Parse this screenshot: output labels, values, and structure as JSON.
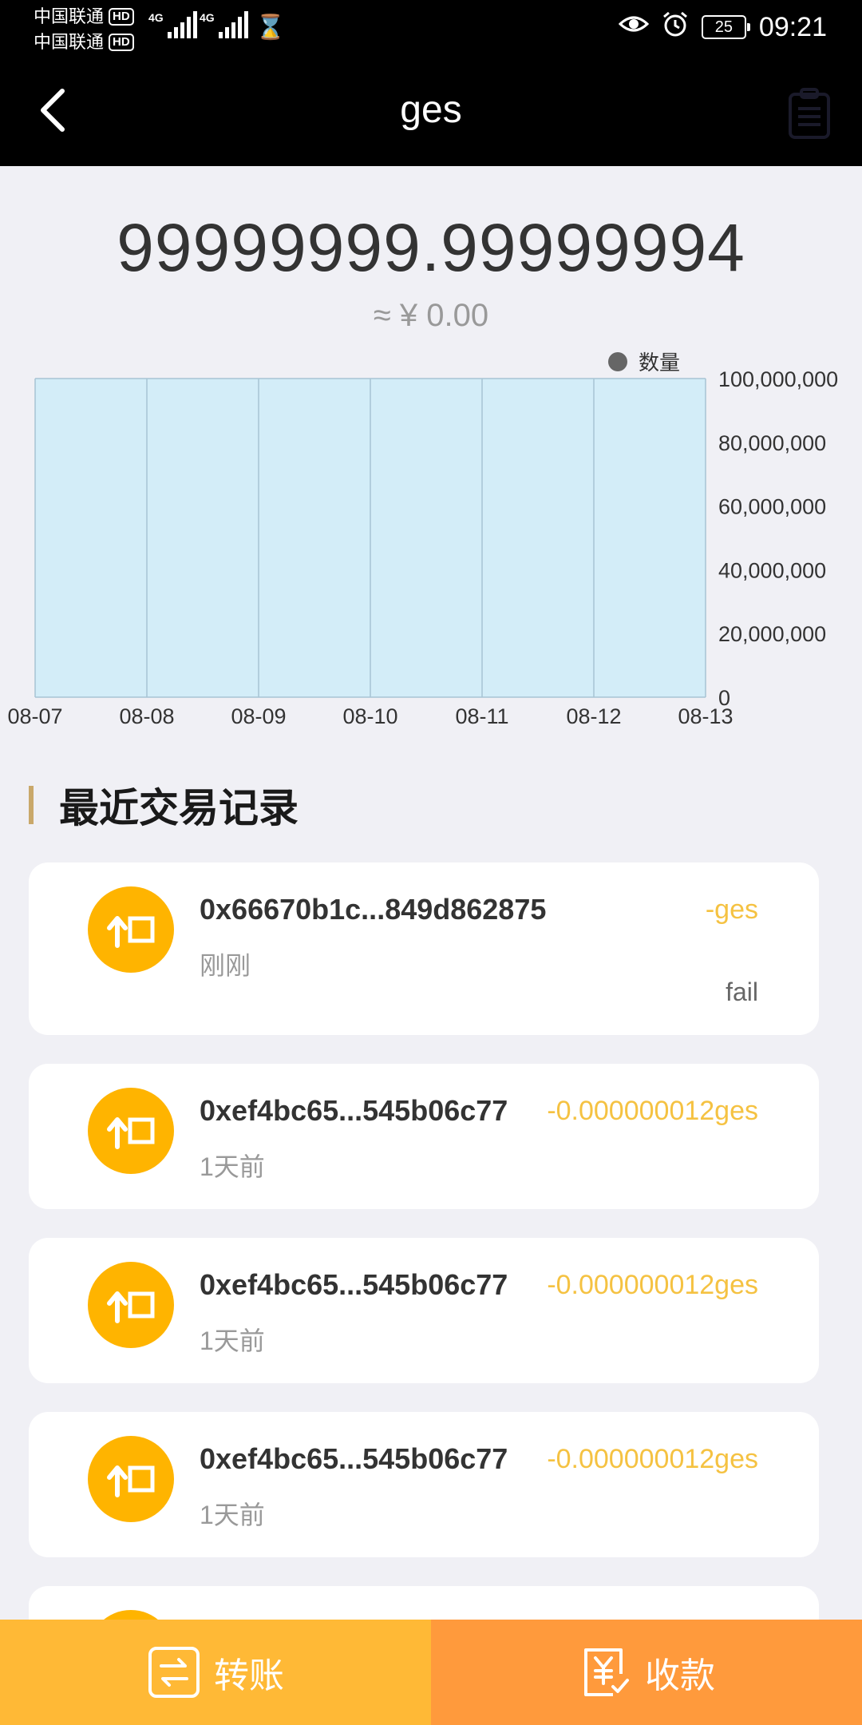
{
  "status_bar": {
    "carrier1": "中国联通",
    "carrier2": "中国联通",
    "hd": "HD",
    "network1": "4G",
    "network2": "4G",
    "battery": "25",
    "time": "09:21"
  },
  "header": {
    "title": "ges",
    "back_icon": "chevron-left-icon",
    "records_icon": "clipboard-icon"
  },
  "balance": {
    "amount": "99999999.99999994",
    "fiat": "≈ ¥ 0.00"
  },
  "chart_data": {
    "type": "area",
    "legend": "数量",
    "x": [
      "08-07",
      "08-08",
      "08-09",
      "08-10",
      "08-11",
      "08-12",
      "08-13"
    ],
    "series": [
      {
        "name": "数量",
        "values": [
          99999999.99999994,
          99999999.99999994,
          99999999.99999994,
          99999999.99999994,
          99999999.99999994,
          99999999.99999994,
          99999999.99999994
        ]
      }
    ],
    "ylim": [
      0,
      100000000
    ],
    "y_ticks": [
      "0",
      "20,000,000",
      "40,000,000",
      "60,000,000",
      "80,000,000",
      "100,000,000"
    ],
    "y_axis_position": "right",
    "fill_color": "#d3edf8",
    "line_color": "#a8c4d4",
    "legend_placement": "top-right"
  },
  "section": {
    "title": "最近交易记录"
  },
  "transactions": [
    {
      "address": "0x66670b1c...849d862875",
      "amount": "-ges",
      "time": "刚刚",
      "status": "fail"
    },
    {
      "address": "0xef4bc65...545b06c77",
      "amount": "-0.000000012ges",
      "time": "1天前",
      "status": ""
    },
    {
      "address": "0xef4bc65...545b06c77",
      "amount": "-0.000000012ges",
      "time": "1天前",
      "status": ""
    },
    {
      "address": "0xef4bc65...545b06c77",
      "amount": "-0.000000012ges",
      "time": "1天前",
      "status": ""
    }
  ],
  "bottom_bar": {
    "transfer_label": "转账",
    "receive_label": "收款"
  },
  "colors": {
    "accent": "#ffb400",
    "amount": "#f5c242",
    "transfer_bg": "#ffb936",
    "receive_bg": "#ff9a3c",
    "section_marker": "#c9a86a"
  }
}
